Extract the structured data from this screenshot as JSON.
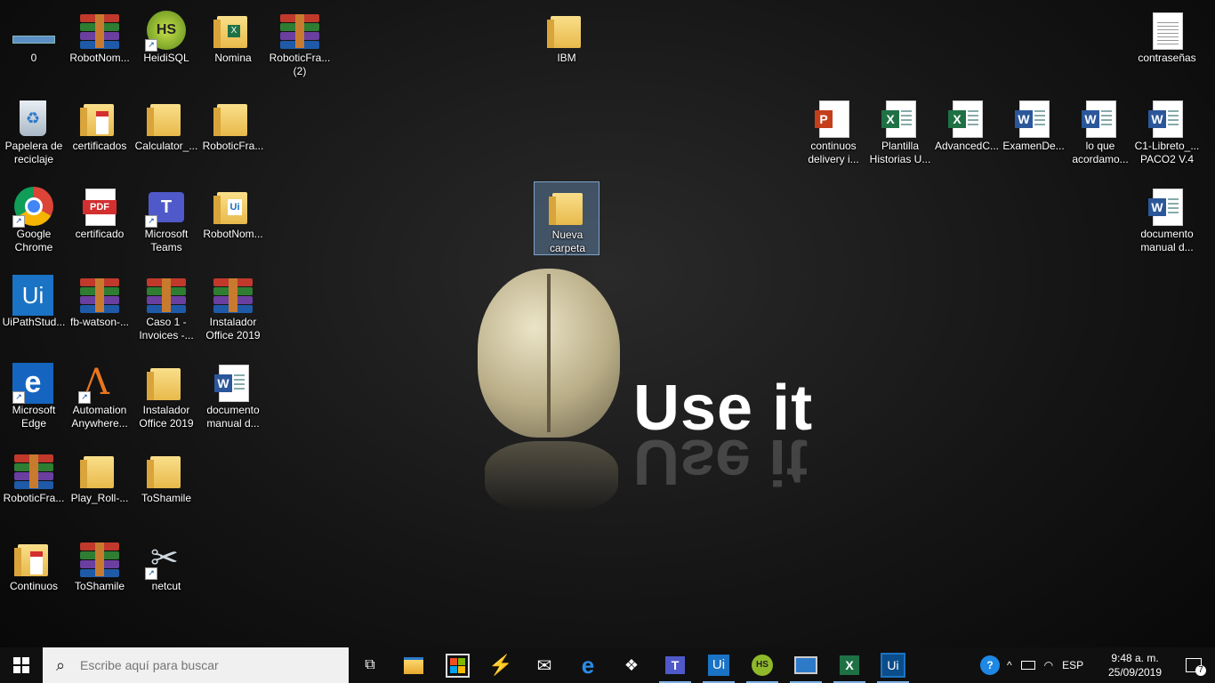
{
  "desktop": {
    "icons": [
      {
        "label": "0",
        "kind": "bar"
      },
      {
        "label": "RobotNom...",
        "kind": "rar"
      },
      {
        "label": "HeidiSQL",
        "kind": "heidi"
      },
      {
        "label": "Nomina",
        "kind": "xlsfolder"
      },
      {
        "label": "RoboticFra... (2)",
        "kind": "rar"
      },
      {
        "label": "IBM",
        "kind": "folder"
      },
      {
        "label": "contraseñas",
        "kind": "txt"
      },
      {
        "label": "Papelera de reciclaje",
        "kind": "recycle"
      },
      {
        "label": "certificados",
        "kind": "pdffolder"
      },
      {
        "label": "Calculator_...",
        "kind": "folder"
      },
      {
        "label": "RoboticFra...",
        "kind": "folder"
      },
      {
        "label": "continuos delivery i...",
        "kind": "ppt"
      },
      {
        "label": "Plantilla Historias U...",
        "kind": "xls"
      },
      {
        "label": "AdvancedC...",
        "kind": "xls"
      },
      {
        "label": "ExamenDe...",
        "kind": "word"
      },
      {
        "label": "lo que acordamo...",
        "kind": "word"
      },
      {
        "label": "C1-Libreto_... PACO2 V.4",
        "kind": "word"
      },
      {
        "label": "Google Chrome",
        "kind": "chrome"
      },
      {
        "label": "certificado",
        "kind": "pdf"
      },
      {
        "label": "Microsoft Teams",
        "kind": "teams"
      },
      {
        "label": "RobotNom...",
        "kind": "uifolder"
      },
      {
        "label": "Nueva carpeta",
        "kind": "folder"
      },
      {
        "label": "documento manual d...",
        "kind": "word"
      },
      {
        "label": "UiPathStud...",
        "kind": "uipath"
      },
      {
        "label": "fb-watson-...",
        "kind": "rar"
      },
      {
        "label": "Caso 1 - Invoices -...",
        "kind": "rar"
      },
      {
        "label": "Instalador Office 2019",
        "kind": "rar"
      },
      {
        "label": "Microsoft Edge",
        "kind": "edge"
      },
      {
        "label": "Automation Anywhere...",
        "kind": "aa"
      },
      {
        "label": "Instalador Office 2019",
        "kind": "folder"
      },
      {
        "label": "documento manual d...",
        "kind": "word"
      },
      {
        "label": "RoboticFra...",
        "kind": "rar"
      },
      {
        "label": "Play_Roll-...",
        "kind": "folder"
      },
      {
        "label": "ToShamile",
        "kind": "folder"
      },
      {
        "label": "Continuos",
        "kind": "pdffolder"
      },
      {
        "label": "ToShamile",
        "kind": "rar"
      },
      {
        "label": "netcut",
        "kind": "scissors"
      }
    ]
  },
  "wallpaper": {
    "slogan": "Use it"
  },
  "taskbar": {
    "search_placeholder": "Escribe aquí para buscar",
    "apps": [
      "task-view",
      "file-explorer",
      "store",
      "power-automate",
      "mail",
      "edge",
      "dropbox",
      "teams",
      "uipath",
      "heidisql",
      "remote-desktop",
      "excel",
      "uipath-studio"
    ],
    "tray": {
      "language": "ESP",
      "time": "9:48 a. m.",
      "date": "25/09/2019",
      "notifications": "7"
    }
  },
  "colors": {
    "taskbar": "#101010",
    "selection": "#78aadc"
  }
}
